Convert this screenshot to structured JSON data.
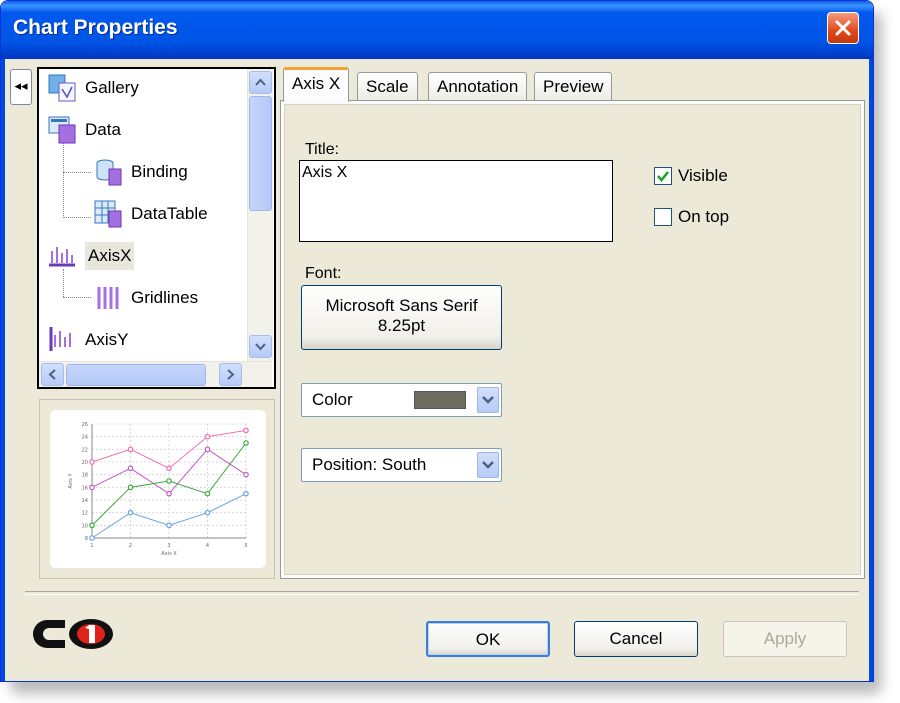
{
  "window": {
    "title": "Chart Properties"
  },
  "nav": {
    "collapse_symbol": "◂◂",
    "items": [
      {
        "label": "Gallery",
        "icon": "gallery-icon"
      },
      {
        "label": "Data",
        "icon": "data-icon"
      },
      {
        "label": "Binding",
        "icon": "binding-icon"
      },
      {
        "label": "DataTable",
        "icon": "datatable-icon"
      },
      {
        "label": "AxisX",
        "icon": "axisx-icon",
        "selected": true
      },
      {
        "label": "Gridlines",
        "icon": "gridlines-icon"
      },
      {
        "label": "AxisY",
        "icon": "axisy-icon"
      }
    ]
  },
  "preview_chart": {
    "ylabel": "Axis Y",
    "xlabel": "Axis X",
    "y_ticks": [
      "26",
      "24",
      "22",
      "20",
      "18",
      "16",
      "14",
      "12",
      "10",
      "8"
    ],
    "x_ticks": [
      "1",
      "2",
      "3",
      "4",
      "5"
    ]
  },
  "chart_data": {
    "type": "line",
    "x": [
      1,
      2,
      3,
      4,
      5
    ],
    "xlabel": "Axis X",
    "ylabel": "Axis Y",
    "ylim": [
      8,
      26
    ],
    "series": [
      {
        "values": [
          20,
          22,
          19,
          24,
          25
        ],
        "color": "#f06bb0"
      },
      {
        "values": [
          16,
          19,
          15,
          22,
          18
        ],
        "color": "#c05ac8"
      },
      {
        "values": [
          10,
          16,
          17,
          15,
          23
        ],
        "color": "#3aa83a"
      },
      {
        "values": [
          8,
          12,
          10,
          12,
          15
        ],
        "color": "#6aa0e0"
      }
    ]
  },
  "tabs": [
    {
      "label": "Axis X",
      "active": true
    },
    {
      "label": "Scale"
    },
    {
      "label": "Annotation"
    },
    {
      "label": "Preview"
    }
  ],
  "axis_form": {
    "title_label": "Title:",
    "title_value": "Axis X",
    "font_label": "Font:",
    "font_name": "Microsoft Sans Serif",
    "font_size": "8.25pt",
    "color_label": "Color",
    "color_value": "#6e6b60",
    "position_label": "Position: South",
    "visible_label": "Visible",
    "visible_checked": true,
    "ontop_label": "On top",
    "ontop_checked": false
  },
  "footer": {
    "ok_label": "OK",
    "cancel_label": "Cancel",
    "apply_label": "Apply"
  }
}
